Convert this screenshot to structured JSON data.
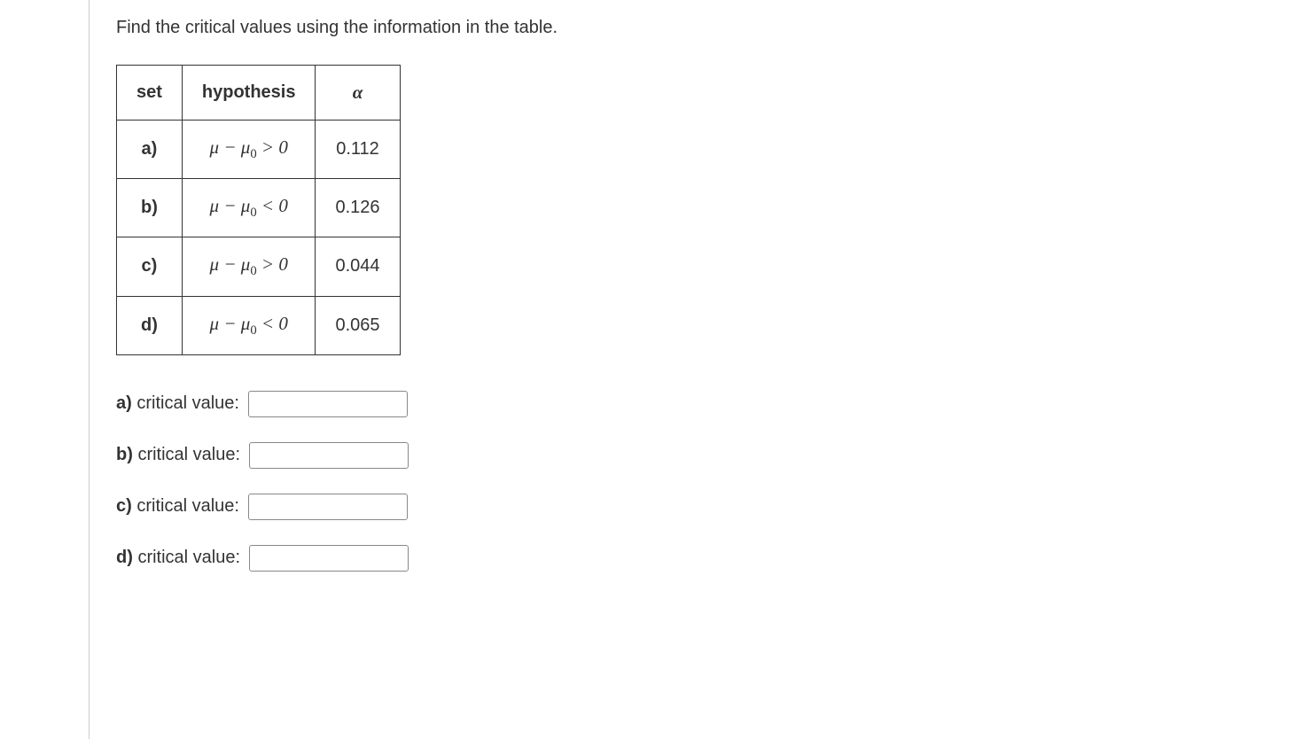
{
  "question": "Find the critical values using the information in the table.",
  "table": {
    "headers": {
      "set": "set",
      "hypothesis": "hypothesis",
      "alpha": "α"
    },
    "rows": [
      {
        "set": "a)",
        "hyp_lhs": "μ − μ",
        "hyp_sub": "0",
        "hyp_rhs": " > 0",
        "alpha": "0.112"
      },
      {
        "set": "b)",
        "hyp_lhs": "μ − μ",
        "hyp_sub": "0",
        "hyp_rhs": " < 0",
        "alpha": "0.126"
      },
      {
        "set": "c)",
        "hyp_lhs": "μ − μ",
        "hyp_sub": "0",
        "hyp_rhs": " > 0",
        "alpha": "0.044"
      },
      {
        "set": "d)",
        "hyp_lhs": "μ − μ",
        "hyp_sub": "0",
        "hyp_rhs": " < 0",
        "alpha": "0.065"
      }
    ]
  },
  "answers": [
    {
      "bold": "a)",
      "label": " critical value: ",
      "value": ""
    },
    {
      "bold": "b)",
      "label": " critical value: ",
      "value": ""
    },
    {
      "bold": "c)",
      "label": " critical value: ",
      "value": ""
    },
    {
      "bold": "d)",
      "label": " critical value: ",
      "value": ""
    }
  ]
}
